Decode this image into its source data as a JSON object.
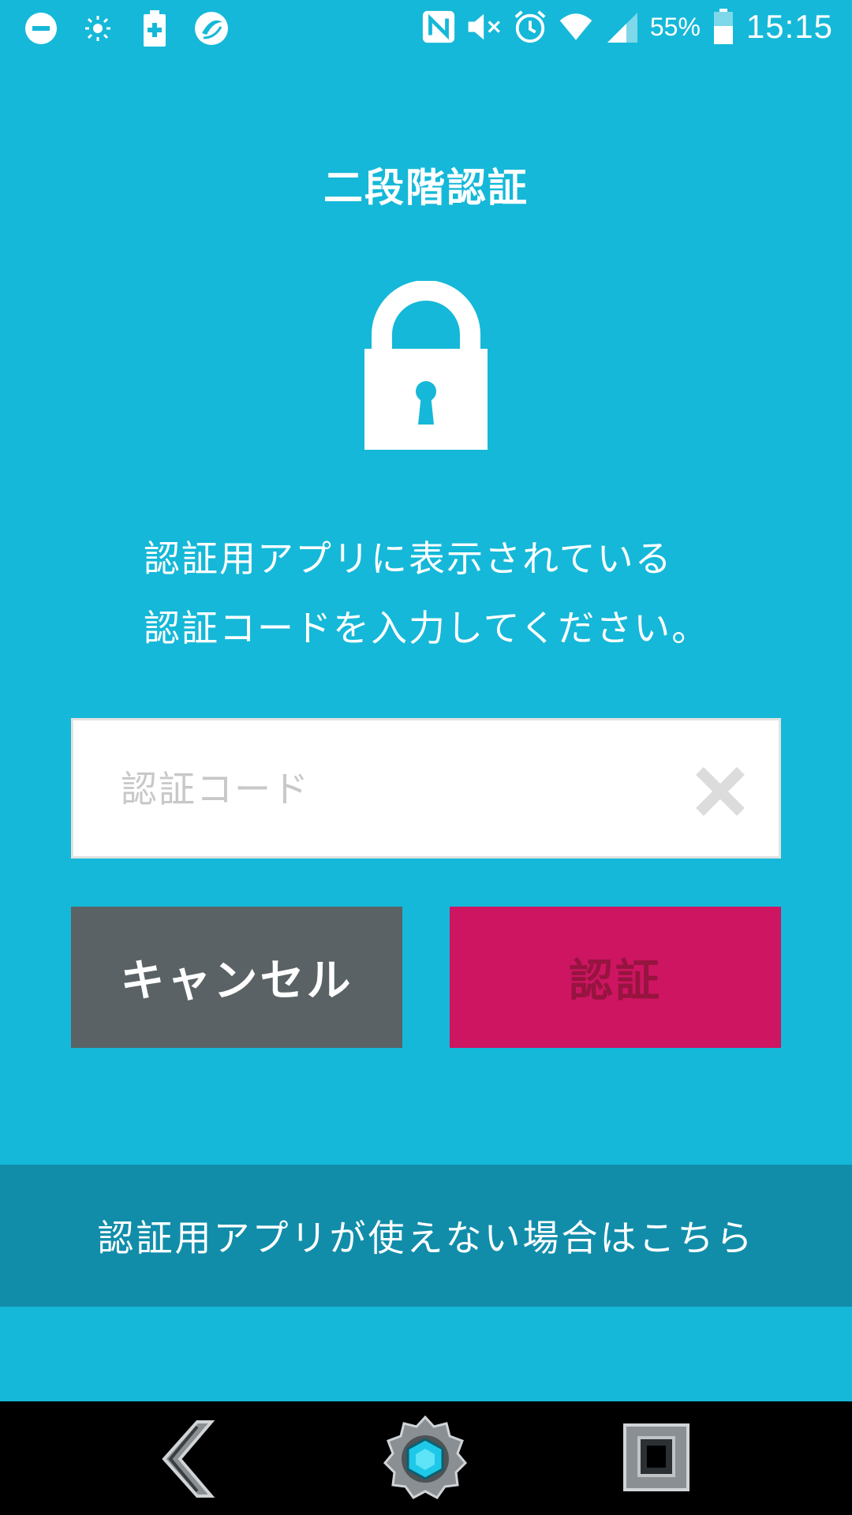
{
  "status_bar": {
    "left_icons": [
      "dnd-icon",
      "brightness-icon",
      "battery-saver-icon",
      "app-notification-icon"
    ],
    "right_icons": [
      "nfc-icon",
      "mute-icon",
      "alarm-icon",
      "wifi-icon",
      "signal-icon",
      "battery-icon"
    ],
    "battery_percent": "55%",
    "time": "15:15"
  },
  "screen": {
    "title": "二段階認証",
    "lock_icon": "lock-icon",
    "instruction_line1": "認証用アプリに表示されている",
    "instruction_line2": "認証コードを入力してください。"
  },
  "code_input": {
    "placeholder": "認証コード",
    "value": "",
    "clear_icon": "clear-x-icon"
  },
  "buttons": {
    "cancel_label": "キャンセル",
    "auth_label": "認証"
  },
  "alt_link": {
    "label": "認証用アプリが使えない場合はこちら"
  },
  "nav_bar": {
    "back_icon": "back-icon",
    "home_icon": "home-icon",
    "recent_icon": "recent-apps-icon"
  },
  "colors": {
    "background": "#15b8d8",
    "cancel_button": "#5a6265",
    "auth_button": "#cd1562",
    "link_band": "#118daa"
  }
}
